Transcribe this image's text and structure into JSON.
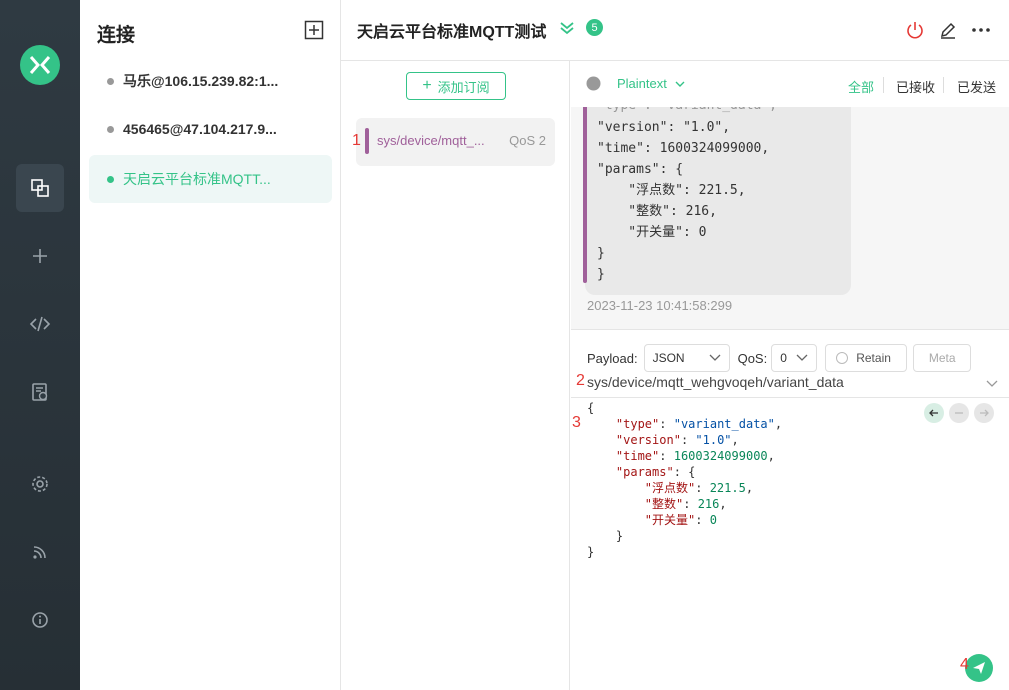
{
  "sidebar": {
    "title": "连接",
    "connections": [
      {
        "name": "马乐@106.15.239.82:1..."
      },
      {
        "name": "456465@47.104.217.9..."
      },
      {
        "name": "天启云平台标准MQTT..."
      }
    ]
  },
  "header": {
    "connection_name": "天启云平台标准MQTT测试",
    "badge_count": "5"
  },
  "subscriptions": {
    "add_label": "添加订阅",
    "items": [
      {
        "topic": "sys/device/mqtt_...",
        "qos": "QoS 2"
      }
    ]
  },
  "messages": {
    "format": "Plaintext",
    "filters": [
      "全部",
      "已接收",
      "已发送"
    ],
    "partial_line": "\"type\": \"variant_data\",",
    "payload": "\"version\": \"1.0\",\n\"time\": 1600324099000,\n\"params\": {\n    \"浮点数\": 221.5,\n    \"整数\": 216,\n    \"开关量\": 0\n}\n}",
    "time": "2023-11-23 10:41:58:299"
  },
  "publish": {
    "payload_label": "Payload:",
    "payload_format": "JSON",
    "qos_label": "QoS:",
    "qos_value": "0",
    "retain_label": "Retain",
    "meta_label": "Meta",
    "topic": "sys/device/mqtt_wehgvoqeh/variant_data"
  },
  "annotations": [
    "1",
    "2",
    "3",
    "4"
  ],
  "colors": {
    "accent": "#34c388",
    "topic": "#a0609a",
    "rail": "#2f3a42"
  }
}
